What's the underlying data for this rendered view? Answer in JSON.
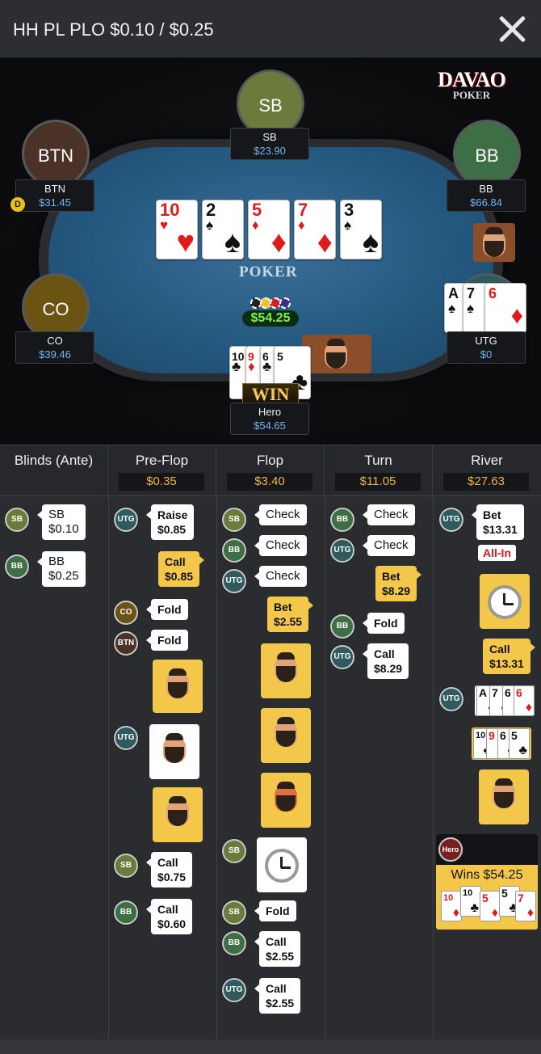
{
  "header": {
    "title": "HH PL PLO $0.10 / $0.25"
  },
  "brand": {
    "line1": "DAVAO",
    "line2": "POKER"
  },
  "table": {
    "felt_logo": "POKER",
    "pot": "$54.25",
    "board": [
      {
        "rank": "10",
        "suit": "♥",
        "color": "red"
      },
      {
        "rank": "2",
        "suit": "♠",
        "color": "blk"
      },
      {
        "rank": "5",
        "suit": "♦",
        "color": "red"
      },
      {
        "rank": "7",
        "suit": "♦",
        "color": "red"
      },
      {
        "rank": "3",
        "suit": "♠",
        "color": "blk"
      }
    ],
    "seats": {
      "sb": {
        "badge": "SB",
        "name": "SB",
        "stack": "$23.90",
        "color": "#6b7b3b"
      },
      "btn": {
        "badge": "BTN",
        "name": "BTN",
        "stack": "$31.45",
        "color": "#4a3326",
        "dealer": "D"
      },
      "bb": {
        "badge": "BB",
        "name": "BB",
        "stack": "$66.84",
        "color": "#3e6e44"
      },
      "co": {
        "badge": "CO",
        "name": "CO",
        "stack": "$39.46",
        "color": "#6b5314"
      },
      "utg": {
        "name": "UTG",
        "stack": "$0",
        "color": "#2f5b60"
      },
      "hero": {
        "name": "Hero",
        "stack": "$54.65",
        "banner": "WIN"
      }
    },
    "utg_hand": [
      {
        "rank": "A",
        "suit": "♠",
        "color": "blk"
      },
      {
        "rank": "7",
        "suit": "♠",
        "color": "blk"
      },
      {
        "rank": "6",
        "suit": "♦",
        "color": "red"
      }
    ],
    "hero_hand": [
      {
        "rank": "10",
        "suit": "♣",
        "color": "blk"
      },
      {
        "rank": "9",
        "suit": "♦",
        "color": "red"
      },
      {
        "rank": "6",
        "suit": "♣",
        "color": "blk"
      },
      {
        "rank": "5",
        "suit": "♣",
        "color": "blk"
      }
    ]
  },
  "history": {
    "columns": [
      {
        "label": "Blinds (Ante)",
        "pot": ""
      },
      {
        "label": "Pre-Flop",
        "pot": "$0.35"
      },
      {
        "label": "Flop",
        "pot": "$3.40"
      },
      {
        "label": "Turn",
        "pot": "$11.05"
      },
      {
        "label": "River",
        "pot": "$27.63"
      }
    ],
    "blinds": [
      {
        "pos": "SB",
        "text": "SB\n$0.10"
      },
      {
        "pos": "BB",
        "text": "BB\n$0.25"
      }
    ],
    "preflop": [
      {
        "pos": "UTG",
        "text": "Raise\n$0.85"
      },
      {
        "pos": "Hero",
        "text": "Call\n$0.85"
      },
      {
        "pos": "CO",
        "text": "Fold"
      },
      {
        "pos": "BTN",
        "text": "Fold"
      },
      {
        "pos": "SB",
        "text": "Call\n$0.75"
      },
      {
        "pos": "BB",
        "text": "Call\n$0.60"
      }
    ],
    "flop": [
      {
        "pos": "SB",
        "text": "Check"
      },
      {
        "pos": "BB",
        "text": "Check"
      },
      {
        "pos": "UTG",
        "text": "Check"
      },
      {
        "pos": "Hero",
        "text": "Bet\n$2.55"
      },
      {
        "pos": "SB",
        "text": "Fold"
      },
      {
        "pos": "BB",
        "text": "Call\n$2.55"
      },
      {
        "pos": "UTG",
        "text": "Call\n$2.55"
      }
    ],
    "turn": [
      {
        "pos": "BB",
        "text": "Check"
      },
      {
        "pos": "UTG",
        "text": "Check"
      },
      {
        "pos": "Hero",
        "text": "Bet\n$8.29"
      },
      {
        "pos": "BB",
        "text": "Fold"
      },
      {
        "pos": "UTG",
        "text": "Call\n$8.29"
      }
    ],
    "river": [
      {
        "pos": "UTG",
        "text": "Bet\n$13.31",
        "tag": "All-In"
      },
      {
        "pos": "Hero",
        "text": "Call\n$13.31"
      }
    ],
    "river_show": {
      "utg_cards": [
        {
          "rank": "A",
          "suit": "♠",
          "color": "blk"
        },
        {
          "rank": "7",
          "suit": "♠",
          "color": "blk"
        },
        {
          "rank": "6",
          "suit": "♠",
          "color": "blk"
        },
        {
          "rank": "6",
          "suit": "♦",
          "color": "red"
        }
      ],
      "hero_cards": [
        {
          "rank": "10",
          "suit": "♣",
          "color": "blk"
        },
        {
          "rank": "9",
          "suit": "♦",
          "color": "red"
        },
        {
          "rank": "6",
          "suit": "♣",
          "color": "blk"
        },
        {
          "rank": "5",
          "suit": "♣",
          "color": "blk"
        }
      ],
      "winner_badge": "Hero",
      "winner_text": "Wins $54.25",
      "win_cards": [
        {
          "rank": "10",
          "suit": "♦",
          "color": "red"
        },
        {
          "rank": "10",
          "suit": "♣",
          "color": "blk"
        },
        {
          "rank": "5",
          "suit": "♦",
          "color": "red"
        },
        {
          "rank": "5",
          "suit": "♣",
          "color": "blk"
        },
        {
          "rank": "7",
          "suit": "♦",
          "color": "red"
        }
      ]
    }
  }
}
